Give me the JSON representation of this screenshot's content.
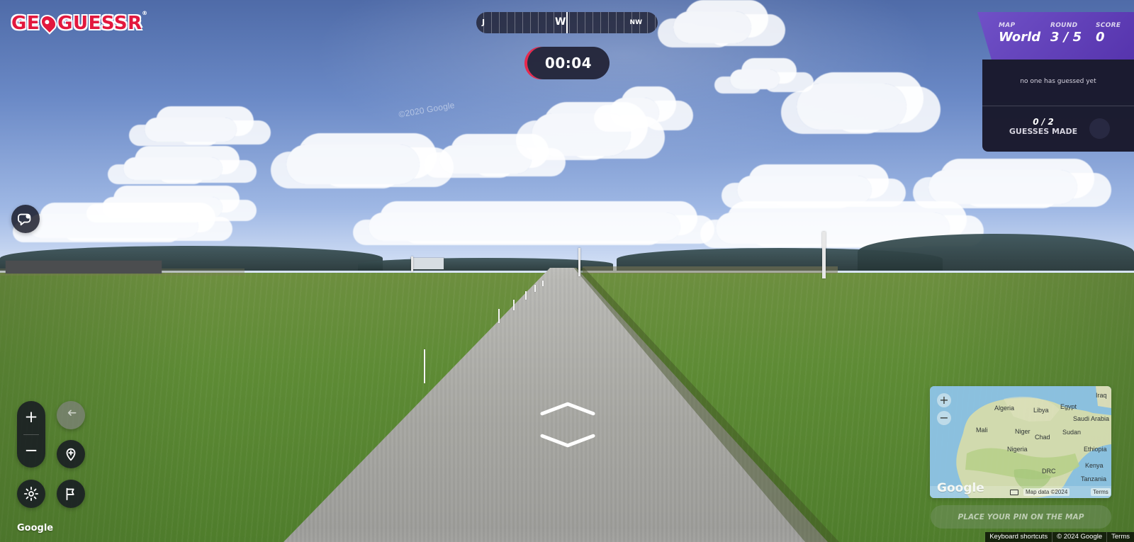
{
  "app": {
    "logo_text": "GE",
    "logo_text_rest": "GUESSR",
    "logo_registered": "®"
  },
  "compass": {
    "left_label": "J",
    "main_label": "W",
    "right_label": "NW"
  },
  "timer": {
    "value": "00:04"
  },
  "status": {
    "map_label": "MAP",
    "map_value": "World",
    "round_label": "ROUND",
    "round_value": "3 / 5",
    "score_label": "SCORE",
    "score_value": "0"
  },
  "guesses": {
    "note": "no one has guessed yet",
    "count": "0 / 2",
    "label": "GUESSES MADE"
  },
  "minimap": {
    "labels": [
      "Algeria",
      "Libya",
      "Egypt",
      "Iraq",
      "Saudi Arabia",
      "Mali",
      "Niger",
      "Chad",
      "Sudan",
      "Nigeria",
      "Ethiopia",
      "Kenya",
      "DRC",
      "Tanzania"
    ],
    "google": "Google",
    "map_data": "Map data ©2024",
    "terms": "Terms"
  },
  "actions": {
    "place_pin": "PLACE YOUR PIN ON THE MAP"
  },
  "panorama": {
    "watermark": "©2020 Google",
    "google": "Google"
  },
  "footer": {
    "keyboard_shortcuts": "Keyboard shortcuts",
    "map_copyright": "© 2024 Google",
    "terms": "Terms"
  },
  "colors": {
    "accent_red": "#e2183e",
    "purple_panel": "#6544bf",
    "dark_panel": "#18172a"
  },
  "icons": {
    "chat": "chat-icon",
    "zoom_in": "plus-icon",
    "zoom_out": "minus-icon",
    "undo": "undo-icon",
    "drop_pin": "pin-icon",
    "settings": "gear-icon",
    "report": "flag-icon",
    "forward": "chevron-up-icon",
    "backward": "chevron-down-icon"
  }
}
